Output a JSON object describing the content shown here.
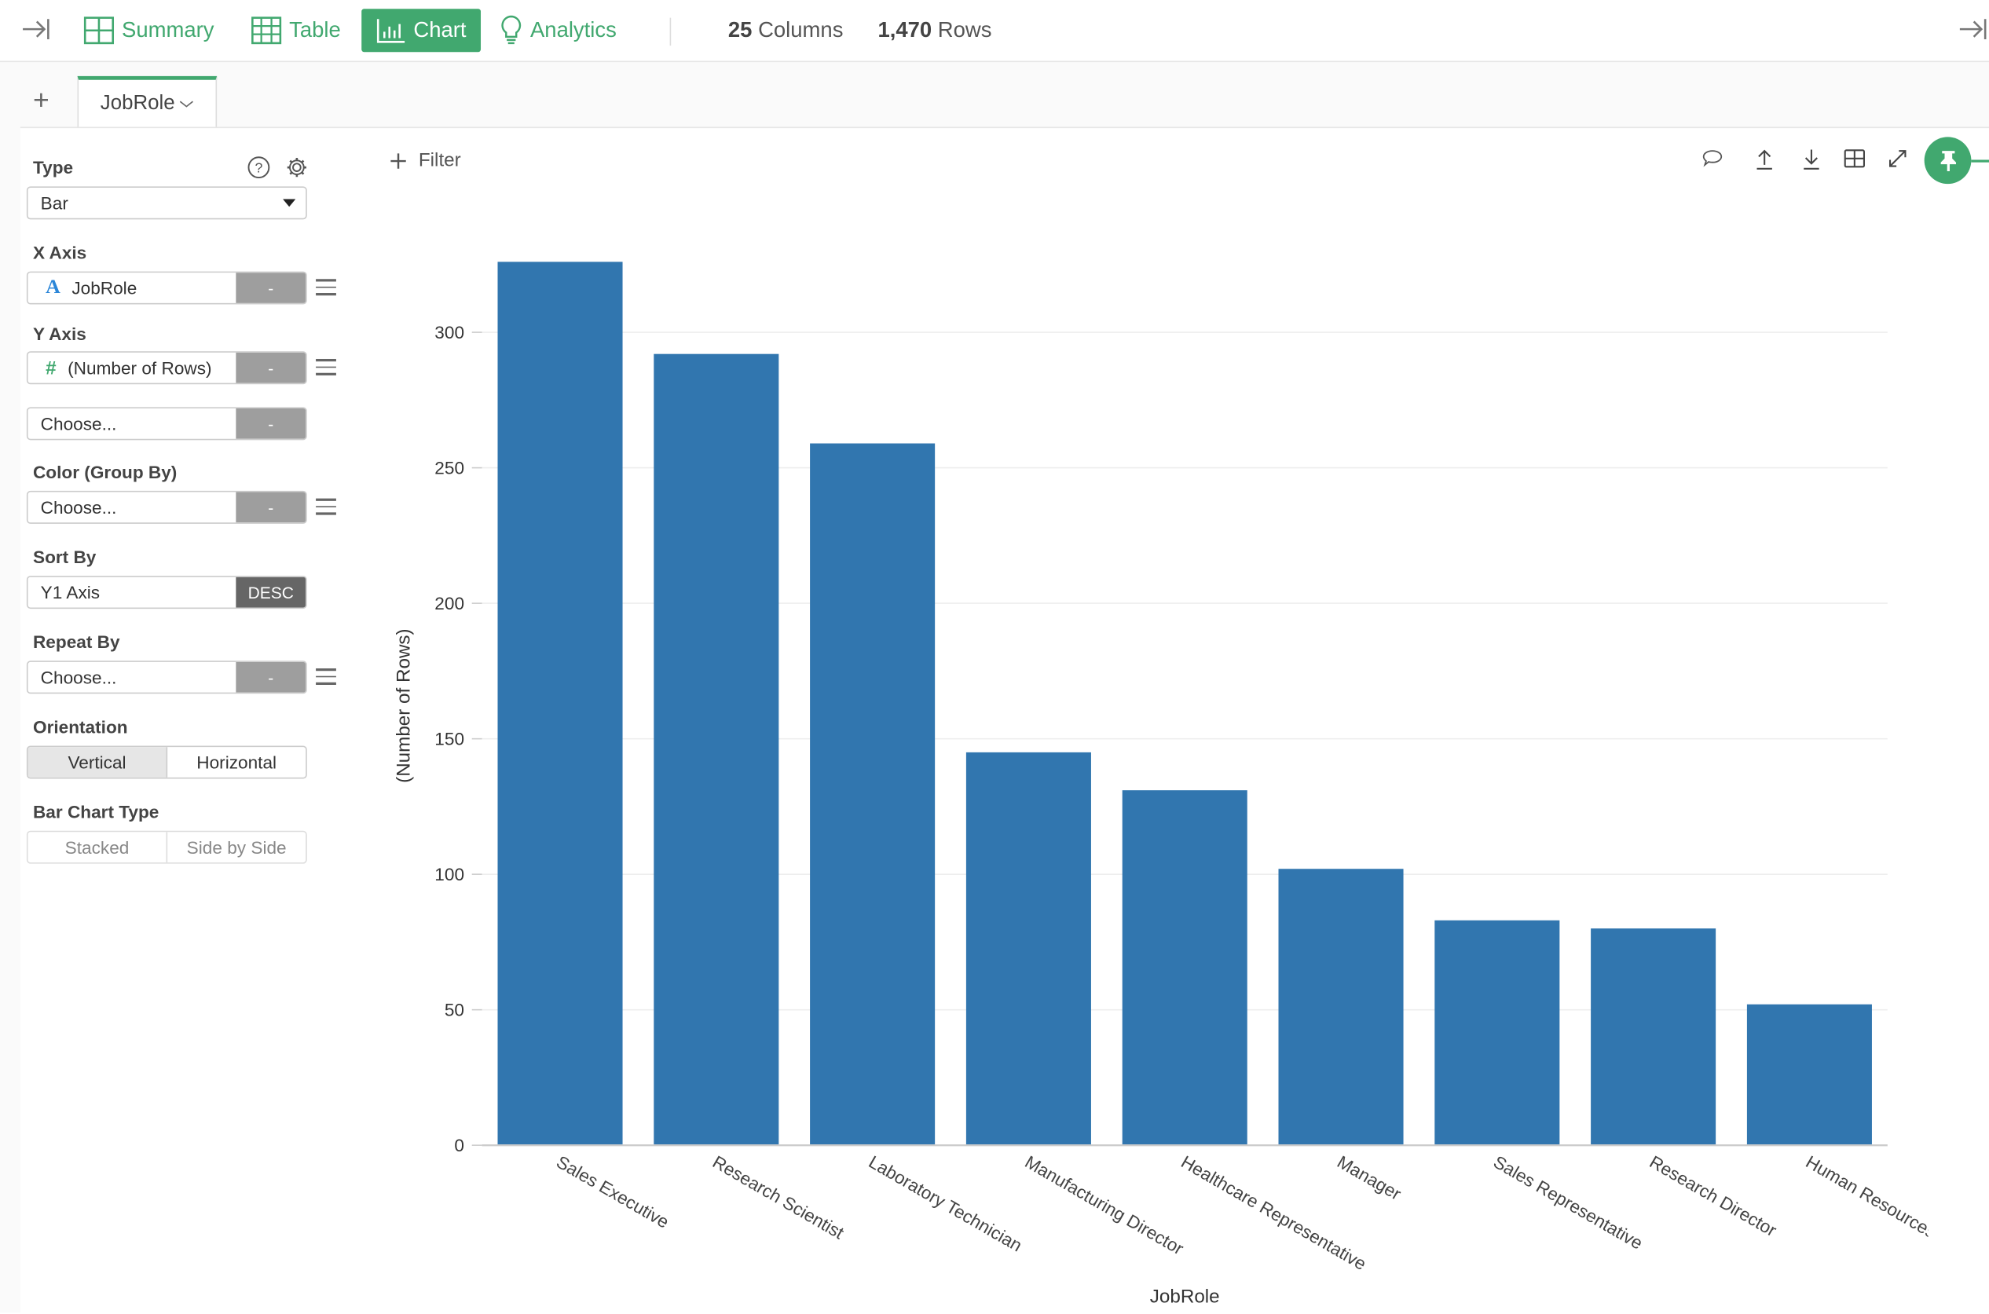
{
  "topbar": {
    "tabs": [
      {
        "label": "Summary",
        "icon": "summary-grid-icon"
      },
      {
        "label": "Table",
        "icon": "table-icon"
      },
      {
        "label": "Chart",
        "icon": "bar-chart-icon",
        "active": true
      },
      {
        "label": "Analytics",
        "icon": "lightbulb-icon"
      }
    ],
    "columns_count": "25",
    "columns_label": "Columns",
    "rows_count": "1,470",
    "rows_label": "Rows"
  },
  "sheet_tabs": {
    "add_label": "+",
    "active_tab": "JobRole"
  },
  "config": {
    "type_label": "Type",
    "type_value": "Bar",
    "x_axis_label": "X Axis",
    "x_axis_value": "JobRole",
    "x_axis_type_glyph": "A",
    "x_axis_btn": "-",
    "y_axis_label": "Y Axis",
    "y_axis_value": "(Number of Rows)",
    "y_axis_type_glyph": "#",
    "y_axis_btn": "-",
    "y2_placeholder": "Choose...",
    "y2_btn": "-",
    "color_label": "Color (Group By)",
    "color_value": "Choose...",
    "color_btn": "-",
    "sort_label": "Sort By",
    "sort_value": "Y1 Axis",
    "sort_order": "DESC",
    "repeat_label": "Repeat By",
    "repeat_value": "Choose...",
    "repeat_btn": "-",
    "orientation_label": "Orientation",
    "orientation_options": [
      "Vertical",
      "Horizontal"
    ],
    "orientation_selected": "Vertical",
    "bar_type_label": "Bar Chart Type",
    "bar_type_options": [
      "Stacked",
      "Side by Side"
    ]
  },
  "toolbar": {
    "filter_label": "Filter"
  },
  "colors": {
    "accent": "#41a86f",
    "bar": "#3176af"
  },
  "chart_data": {
    "type": "bar",
    "title": "",
    "xlabel": "JobRole",
    "ylabel": "(Number of Rows)",
    "categories": [
      "Sales Executive",
      "Research Scientist",
      "Laboratory Technician",
      "Manufacturing Director",
      "Healthcare Representative",
      "Manager",
      "Sales Representative",
      "Research Director",
      "Human Resources"
    ],
    "values": [
      326,
      292,
      259,
      145,
      131,
      102,
      83,
      80,
      52
    ],
    "ylim": [
      0,
      330
    ],
    "yticks": [
      0,
      50,
      100,
      150,
      200,
      250,
      300
    ],
    "grid": true,
    "legend": "none"
  }
}
